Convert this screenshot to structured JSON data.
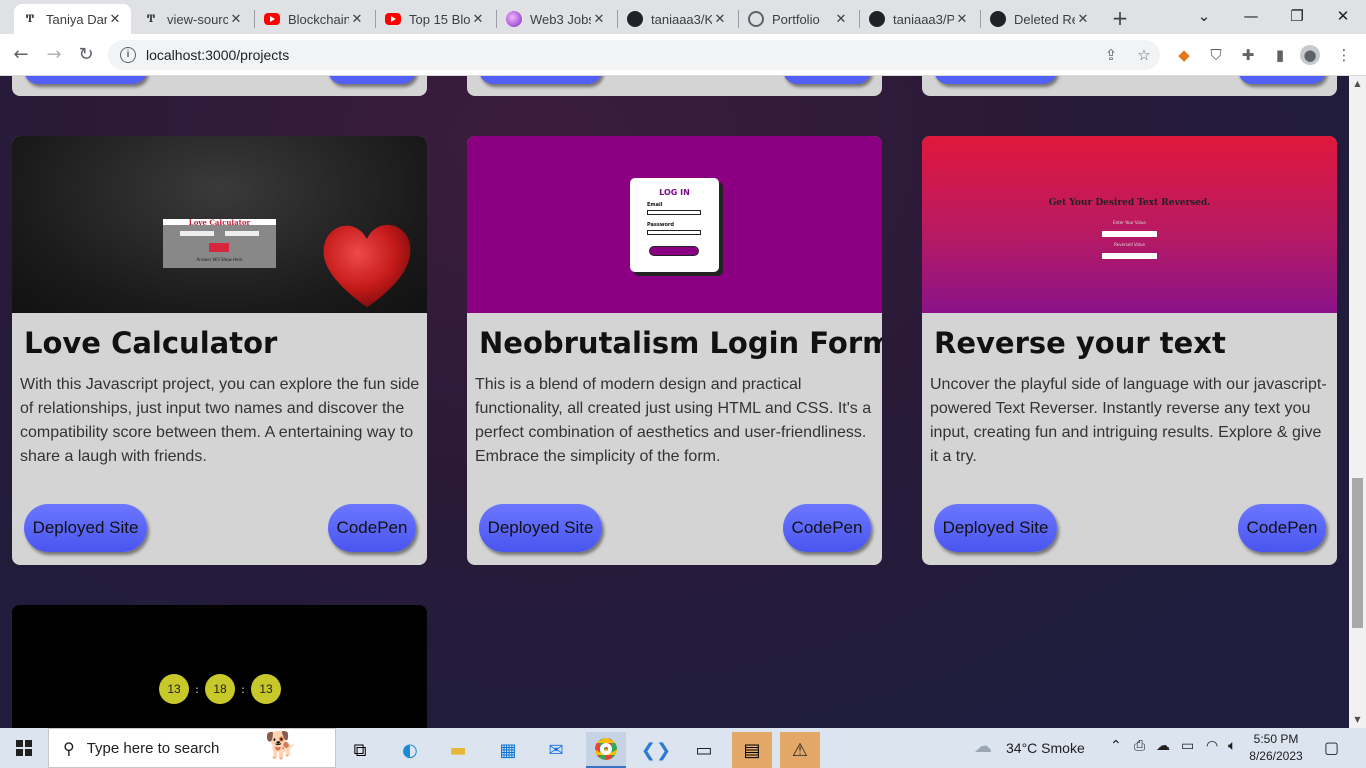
{
  "browser": {
    "tabs": [
      {
        "title": "Taniya Dar",
        "favicon": "taniya-p-icon",
        "active": true
      },
      {
        "title": "view-sourc",
        "favicon": "taniya-p-icon",
        "active": false
      },
      {
        "title": "Blockchain",
        "favicon": "youtube-icon",
        "active": false
      },
      {
        "title": "Top 15 Blo",
        "favicon": "youtube-icon",
        "active": false
      },
      {
        "title": "Web3 Jobs",
        "favicon": "web3-icon",
        "active": false
      },
      {
        "title": "taniaaa3/K",
        "favicon": "github-icon",
        "active": false
      },
      {
        "title": "Portfolio",
        "favicon": "globe-icon",
        "active": false
      },
      {
        "title": "taniaaa3/P",
        "favicon": "github-icon",
        "active": false
      },
      {
        "title": "Deleted Re",
        "favicon": "github-icon",
        "active": false
      }
    ],
    "new_tab": "+",
    "url": "localhost:3000/projects"
  },
  "projects": [
    {
      "title": "Love Calculator",
      "description": "With this Javascript project, you can explore the fun side of relationships, just input two names and discover the compatibility score between them. A entertaining way to share a laugh with friends.",
      "deployed_label": "Deployed Site",
      "codepen_label": "CodePen",
      "thumb": {
        "heading": "Love Calculator",
        "button": "Click",
        "result": "Answer Will Show Here",
        "input1": "Enter first name",
        "input2": "Enter second name"
      }
    },
    {
      "title": "Neobrutalism Login Form",
      "description": "This is a blend of modern design and practical functionality, all created just using HTML and CSS. It's a perfect combination of aesthetics and user-friendliness. Embrace the simplicity of the form.",
      "deployed_label": "Deployed Site",
      "codepen_label": "CodePen",
      "thumb": {
        "heading": "LOG IN",
        "email_label": "Email",
        "password_label": "Password"
      }
    },
    {
      "title": "Reverse your text",
      "description": "Uncover the playful side of language with our javascript-powered Text Reverser. Instantly reverse any text you input, creating fun and intriguing results. Explore & give it a try.",
      "deployed_label": "Deployed Site",
      "codepen_label": "CodePen",
      "thumb": {
        "heading": "Get Your Desired Text Reversed.",
        "label1": "Enter Your Value",
        "label2": "Reversed Value"
      }
    }
  ],
  "clock_project": {
    "hours": "13",
    "minutes": "18",
    "seconds": "13",
    "separator": ":"
  },
  "taskbar": {
    "search_placeholder": "Type here to search",
    "weather": "34°C  Smoke",
    "time": "5:50 PM",
    "date": "8/26/2023"
  },
  "colors": {
    "card_bg": "#d4d4d4",
    "button": "#5360f4",
    "page_bg": "#2a1a38"
  }
}
